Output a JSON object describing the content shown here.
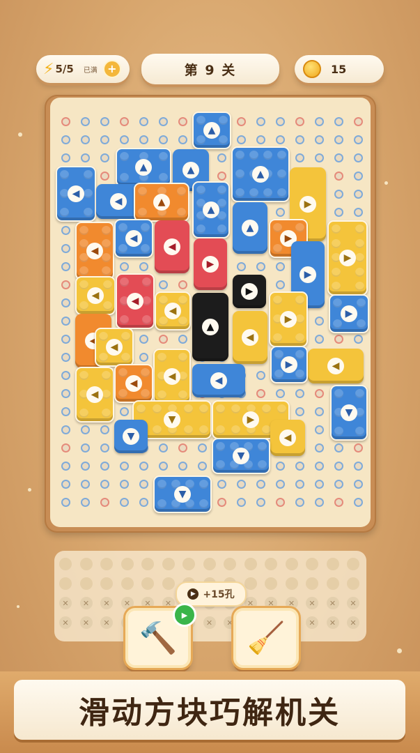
{
  "hud": {
    "energy": {
      "value": "5/5",
      "status": "已满"
    },
    "level_title": "第 9 关",
    "coins": "15"
  },
  "board": {
    "hole_ring_colors": {
      "blue": "#7eaad9",
      "red": "#e58a7a"
    },
    "block_colors": {
      "blue": "#3f86d8",
      "yellow": "#f4c43b",
      "orange": "#f18a2e",
      "red": "#e34c55",
      "black": "#1c1c1c"
    }
  },
  "tray": {
    "bonus_label": "+15孔"
  },
  "tools": {
    "hammer": "hammer-icon",
    "broom": "broom-icon"
  },
  "banner": {
    "text": "滑动方块巧解机关"
  }
}
